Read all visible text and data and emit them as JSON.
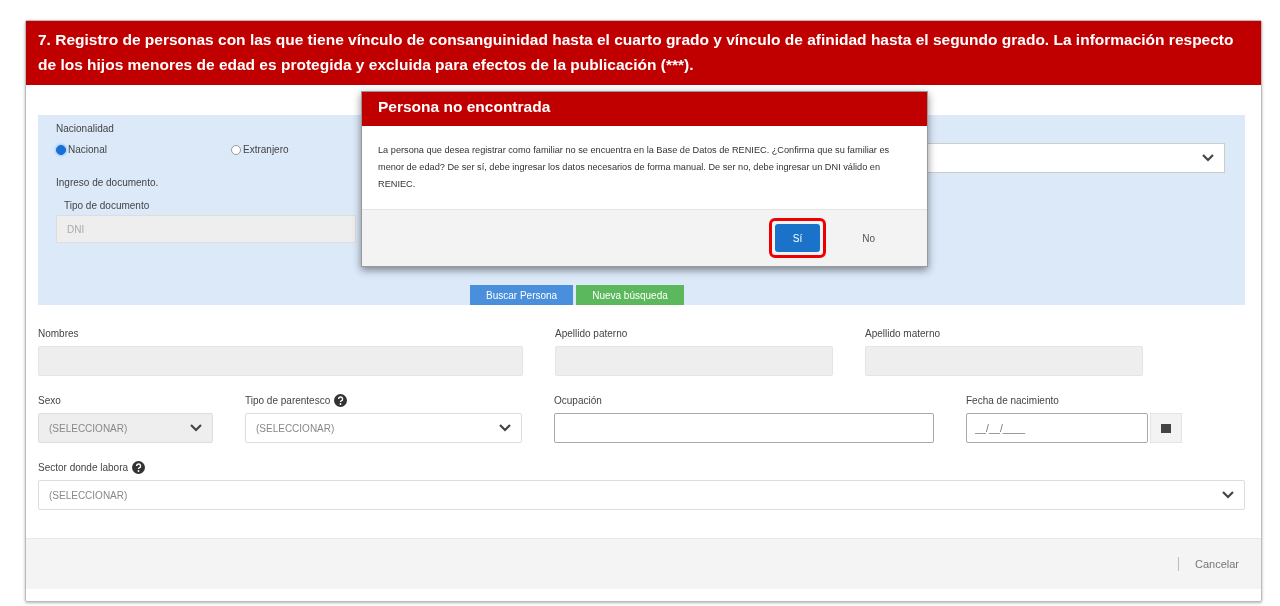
{
  "section_title": "7. Registro de personas con las que tiene vínculo de consanguinidad hasta el cuarto grado y vínculo de afinidad hasta el segundo grado. La información respecto de los hijos menores de edad es protegida y excluida para efectos de la publicación (***).",
  "nationality": {
    "label": "Nacionalidad",
    "options": [
      {
        "label": "Nacional",
        "selected": true
      },
      {
        "label": "Extranjero",
        "selected": false
      }
    ]
  },
  "document_entry": {
    "label": "Ingreso de documento.",
    "doc_type": {
      "label": "Tipo de documento",
      "value": "DNI",
      "disabled": true
    }
  },
  "search_buttons": [
    {
      "label": "Buscar Persona",
      "kind": "primary"
    },
    {
      "label": "Nueva búsqueda",
      "kind": "success"
    }
  ],
  "field_rows": [
    [
      {
        "label": "Nombres",
        "kind": "text",
        "disabled": true,
        "help": false
      },
      {
        "label": "Apellido paterno",
        "kind": "text",
        "disabled": true,
        "help": false
      },
      {
        "label": "Apellido materno",
        "kind": "text",
        "disabled": true,
        "help": false
      }
    ],
    [
      {
        "label": "Sexo",
        "kind": "select",
        "value": "(SELECCIONAR)",
        "disabled": true,
        "help": false
      },
      {
        "label": "Tipo de parentesco",
        "kind": "select",
        "value": "(SELECCIONAR)",
        "disabled": false,
        "help": true
      },
      {
        "label": "Ocupación",
        "kind": "text",
        "disabled": false,
        "help": false
      },
      {
        "label": "Fecha de nacimiento",
        "kind": "date",
        "placeholder": "__/__/____",
        "disabled": false,
        "help": false
      }
    ],
    [
      {
        "label": "Sector donde labora",
        "kind": "select",
        "value": "(SELECCIONAR)",
        "disabled": false,
        "help": true
      }
    ]
  ],
  "dialog": {
    "title": "Persona no encontrada",
    "message": "La persona que desea registrar como familiar no se encuentra en la Base de Datos de RENIEC. ¿Confirma que su familiar es menor de edad? De ser sí, debe ingresar los datos necesarios de forma manual. De ser no, debe ingresar un DNI válido en RENIEC.",
    "buttons": [
      {
        "label": "Sí",
        "kind": "primary",
        "highlighted": true
      },
      {
        "label": "No",
        "kind": "link",
        "highlighted": false
      }
    ]
  },
  "footer": {
    "cancel": "Cancelar"
  }
}
